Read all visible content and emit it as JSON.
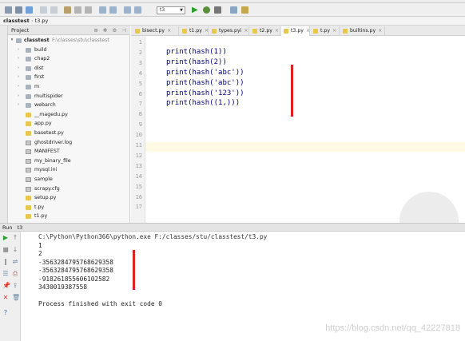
{
  "breadcrumb": {
    "project": "classtest",
    "file": "t3.py"
  },
  "toolbar": {
    "run_config": "t3"
  },
  "project_panel": {
    "title": "Project",
    "root": {
      "name": "classtest",
      "path": "F:\\classes\\stu\\classtest"
    },
    "items": [
      {
        "label": "build",
        "type": "folder"
      },
      {
        "label": "chap2",
        "type": "folder"
      },
      {
        "label": "dist",
        "type": "folder"
      },
      {
        "label": "first",
        "type": "folder"
      },
      {
        "label": "m",
        "type": "folder"
      },
      {
        "label": "multispider",
        "type": "folder"
      },
      {
        "label": "webarch",
        "type": "folder"
      },
      {
        "label": "__magedu.py",
        "type": "py"
      },
      {
        "label": "app.py",
        "type": "py"
      },
      {
        "label": "basetest.py",
        "type": "py"
      },
      {
        "label": "ghostdriver.log",
        "type": "txt"
      },
      {
        "label": "MANIFEST",
        "type": "txt"
      },
      {
        "label": "my_binary_file",
        "type": "txt"
      },
      {
        "label": "mysql.ini",
        "type": "txt"
      },
      {
        "label": "sample",
        "type": "txt"
      },
      {
        "label": "scrapy.cfg",
        "type": "txt"
      },
      {
        "label": "setup.py",
        "type": "py"
      },
      {
        "label": "t.py",
        "type": "py"
      },
      {
        "label": "t1.py",
        "type": "py"
      }
    ]
  },
  "tabs": [
    {
      "label": "bisect.py",
      "active": false
    },
    {
      "label": "t1.py",
      "active": false
    },
    {
      "label": "types.pyi",
      "active": false
    },
    {
      "label": "t2.py",
      "active": false
    },
    {
      "label": "t3.py",
      "active": true
    },
    {
      "label": "t.py",
      "active": false
    },
    {
      "label": "builtins.py",
      "active": false
    }
  ],
  "editor": {
    "line_numbers": [
      "1",
      "2",
      "3",
      "4",
      "5",
      "6",
      "7",
      "8",
      "9",
      "10",
      "11",
      "12",
      "13",
      "14",
      "15",
      "16",
      "17"
    ],
    "code_lines": [
      "",
      "print(hash(1))",
      "print(hash(2))",
      "print(hash('abc'))",
      "print(hash('abc'))",
      "print(hash('123'))",
      "print(hash((1,)))"
    ]
  },
  "run_panel": {
    "label": "Run",
    "config": "t3",
    "output": [
      "C:\\Python\\Python366\\python.exe F:/classes/stu/classtest/t3.py",
      "1",
      "2",
      "-3563284795768629358",
      "-3563284795768629358",
      "-918261855606102582",
      "3430019387558",
      "",
      "Process finished with exit code 0"
    ]
  },
  "watermark": "https://blog.csdn.net/qq_42227818",
  "colors": {
    "annotation_red": "#e02020",
    "tab_active": "#ffffff"
  }
}
